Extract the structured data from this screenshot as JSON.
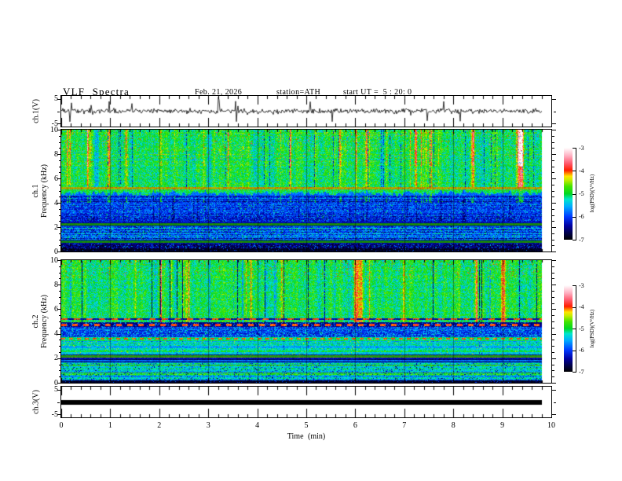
{
  "header": {
    "title": "VLF Spectra",
    "date": "Feb. 21, 2026",
    "station": "station=ATH",
    "start_ut": "start UT =  5 : 20: 0"
  },
  "axes": {
    "x": {
      "label": "Time  (min)",
      "ticks": [
        "0",
        "1",
        "2",
        "3",
        "4",
        "5",
        "6",
        "7",
        "8",
        "9",
        "10"
      ],
      "tick_values": [
        0,
        1,
        2,
        3,
        4,
        5,
        6,
        7,
        8,
        9,
        10
      ],
      "range_min": [
        0,
        10
      ],
      "minor_step_min": 0.2
    },
    "wave_y": {
      "ticks": [
        "5",
        "-5"
      ],
      "tick_values": [
        5,
        -5
      ],
      "range_V": [
        -5,
        5
      ]
    },
    "spec_y": {
      "ticks": [
        "10",
        "8",
        "6",
        "4",
        "2",
        "0"
      ],
      "tick_values": [
        10,
        8,
        6,
        4,
        2,
        0
      ],
      "range_kHz": [
        0,
        10
      ]
    }
  },
  "ylabels": {
    "wave1": "ch.1(V)",
    "spec1_ch": "ch.1",
    "spec2_ch": "ch.2",
    "freq": "Frequency  (kHz)",
    "wave3": "ch.3(V)"
  },
  "colorbar": {
    "label": "log(PSD)(V²/Hz)",
    "ticks": [
      "-3",
      "-4",
      "-5",
      "-6",
      "-7"
    ],
    "tick_values": [
      -3,
      -4,
      -5,
      -6,
      -7
    ],
    "range": [
      -7,
      -3
    ],
    "stops": [
      [
        0,
        "#000000"
      ],
      [
        0.07,
        "#000046"
      ],
      [
        0.15,
        "#0000a0"
      ],
      [
        0.25,
        "#0038ff"
      ],
      [
        0.36,
        "#00aaff"
      ],
      [
        0.44,
        "#00e6cc"
      ],
      [
        0.5,
        "#00d822"
      ],
      [
        0.58,
        "#44e400"
      ],
      [
        0.65,
        "#c8ec00"
      ],
      [
        0.69,
        "#ffe400"
      ],
      [
        0.72,
        "#ff8c00"
      ],
      [
        0.755,
        "#ff1e00"
      ],
      [
        0.83,
        "#ff5a6e"
      ],
      [
        0.91,
        "#ffaec0"
      ],
      [
        0.97,
        "#ffe4ea"
      ],
      [
        1,
        "#ffffff"
      ]
    ]
  },
  "chart_data": [
    {
      "type": "line",
      "name": "ch.1(V) waveform",
      "x_range_min": [
        0,
        9.8
      ],
      "y_range_V": [
        -5,
        5
      ],
      "baseline_V": 0,
      "noise_sigma_V": 0.5,
      "spike_amplitude_V": 4.5,
      "spike_rate_per_point": 0.022
    },
    {
      "type": "heatmap",
      "name": "ch.1 spectrogram",
      "x_range_min": [
        0,
        9.8
      ],
      "y_range_kHz": [
        0,
        10
      ],
      "z_label": "log(PSD)(V²/Hz)",
      "z_range": [
        -7,
        -3
      ],
      "bands": [
        {
          "f": [
            5.08,
            5.26
          ],
          "style": "dark_red_line",
          "level": -4.2,
          "dim": 0.78
        },
        {
          "f": [
            5.26,
            10.01
          ],
          "style": "green_warm_streaks",
          "level": -5.0
        },
        {
          "f": [
            4.55,
            5.08
          ],
          "style": "green_blue_transition",
          "level": -5.05
        },
        {
          "f": [
            2.42,
            4.55
          ],
          "style": "blue_mottle",
          "level": -6.15
        },
        {
          "f": [
            2.05,
            2.42
          ],
          "style": "olive_band",
          "level": -4.85,
          "dim": 0.62
        },
        {
          "f": [
            0.95,
            2.05
          ],
          "style": "cyan_blue_mottle",
          "level": -5.9
        },
        {
          "f": [
            0.62,
            0.95
          ],
          "style": "olive_band",
          "level": -4.85,
          "dim": 0.6
        },
        {
          "f": [
            0.24,
            0.62
          ],
          "style": "dark_blue",
          "level": -6.6
        },
        {
          "f": [
            0,
            0.24
          ],
          "style": "black_band",
          "level": -6.95
        }
      ]
    },
    {
      "type": "heatmap",
      "name": "ch.2 spectrogram",
      "x_range_min": [
        0,
        9.8
      ],
      "y_range_kHz": [
        0,
        10
      ],
      "z_label": "log(PSD)(V²/Hz)",
      "z_range": [
        -7,
        -3
      ],
      "bands": [
        {
          "f": [
            5.1,
            5.28
          ],
          "style": "red_dashes",
          "level": -4.3
        },
        {
          "f": [
            4.92,
            10.01
          ],
          "style": "green_warm_streaks2",
          "level": -5.0
        },
        {
          "f": [
            4.55,
            4.92
          ],
          "style": "dark_red_dash_band",
          "level": -6.7
        },
        {
          "f": [
            3.72,
            4.55
          ],
          "style": "blue_speckle",
          "level": -6.1
        },
        {
          "f": [
            3.42,
            3.72
          ],
          "style": "red_dash_on_green",
          "level": -4.5
        },
        {
          "f": [
            2.32,
            3.42
          ],
          "style": "green_cyan_rows",
          "level": -5.25
        },
        {
          "f": [
            1.95,
            2.32
          ],
          "style": "olive_band",
          "level": -4.75,
          "dim": 0.68
        },
        {
          "f": [
            1.62,
            1.95
          ],
          "style": "dark_rows",
          "level": -5.9
        },
        {
          "f": [
            0.2,
            1.62
          ],
          "style": "green_speckle_rows",
          "level": -5.35
        },
        {
          "f": [
            0,
            0.2
          ],
          "style": "black_band",
          "level": -6.95
        }
      ]
    },
    {
      "type": "line",
      "name": "ch.3(V) waveform",
      "x_range_min": [
        0,
        9.8
      ],
      "y_range_V": [
        -5,
        5
      ],
      "constant_value_V": 0,
      "line_thickness_px": 6
    }
  ]
}
